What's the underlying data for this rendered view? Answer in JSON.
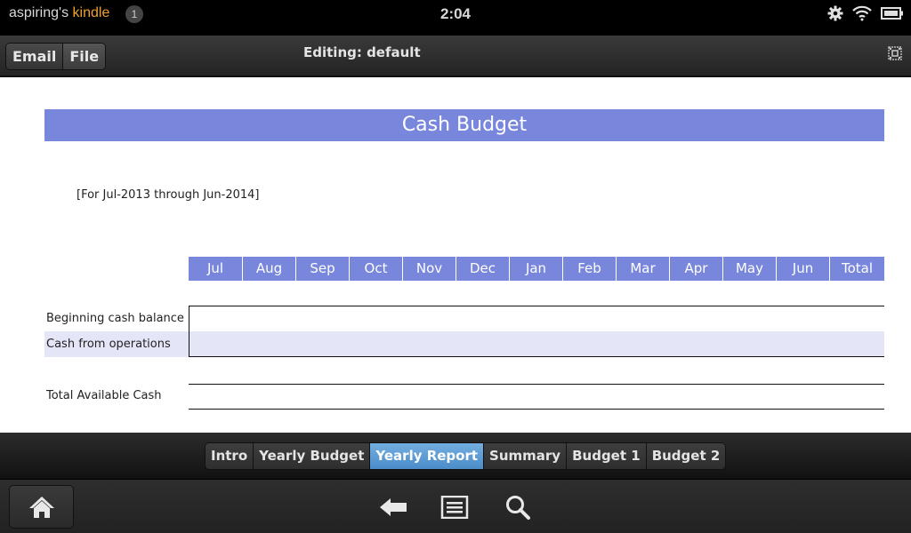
{
  "status_bar": {
    "owner_prefix": "aspiring's ",
    "owner_brand": "kindle",
    "notification_count": "1",
    "time": "2:04",
    "icons": [
      "gear-icon",
      "wifi-icon",
      "battery-icon"
    ]
  },
  "toolbar": {
    "email_label": "Email",
    "file_label": "File",
    "editing_label": "Editing: default",
    "fullscreen_icon": "fullscreen-icon"
  },
  "sheet": {
    "title": "Cash Budget",
    "subtitle": "[For Jul-2013 through Jun-2014]",
    "columns": [
      "Jul",
      "Aug",
      "Sep",
      "Oct",
      "Nov",
      "Dec",
      "Jan",
      "Feb",
      "Mar",
      "Apr",
      "May",
      "Jun",
      "Total"
    ],
    "rows": [
      {
        "label": "Beginning cash balance",
        "values": [
          "",
          "",
          "",
          "",
          "",
          "",
          "",
          "",
          "",
          "",
          "",
          "",
          ""
        ]
      },
      {
        "label": "Cash from operations",
        "values": [
          "",
          "",
          "",
          "",
          "",
          "",
          "",
          "",
          "",
          "",
          "",
          "",
          ""
        ]
      },
      {
        "label": "Total Available Cash",
        "values": [
          "",
          "",
          "",
          "",
          "",
          "",
          "",
          "",
          "",
          "",
          "",
          "",
          ""
        ]
      }
    ],
    "colors": {
      "header_blue": "#7886dc",
      "row_shade": "#e4e6f8"
    }
  },
  "tabs": {
    "items": [
      {
        "label": "Intro",
        "active": false
      },
      {
        "label": "Yearly Budget",
        "active": false
      },
      {
        "label": "Yearly Report",
        "active": true
      },
      {
        "label": "Summary",
        "active": false
      },
      {
        "label": "Budget 1",
        "active": false
      },
      {
        "label": "Budget 2",
        "active": false
      }
    ],
    "active_color": "#4b8cc8"
  },
  "nav": {
    "icons": [
      "home-icon",
      "back-arrow-icon",
      "menu-icon",
      "search-icon"
    ]
  }
}
